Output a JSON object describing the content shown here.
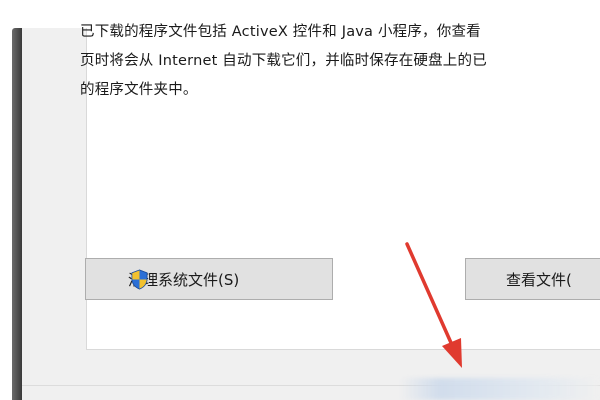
{
  "dialog": {
    "description_lines": [
      "已下载的程序文件包括 ActiveX 控件和 Java 小程序，你查看",
      "页时将会从 Internet 自动下载它们，并临时保存在硬盘上的已",
      "的程序文件夹中。"
    ],
    "cleanup_button_label": "清理系统文件(S)",
    "view_files_button_label": "查看文件(",
    "cleanup_icon": "uac-shield-icon"
  },
  "colors": {
    "window_bg": "#f0f0f0",
    "panel_bg": "#ffffff",
    "button_bg": "#e1e1e1",
    "button_border": "#adadad",
    "arrow": "#e03a2f",
    "shield_blue": "#2b6fd6",
    "shield_yellow": "#f2c230"
  }
}
